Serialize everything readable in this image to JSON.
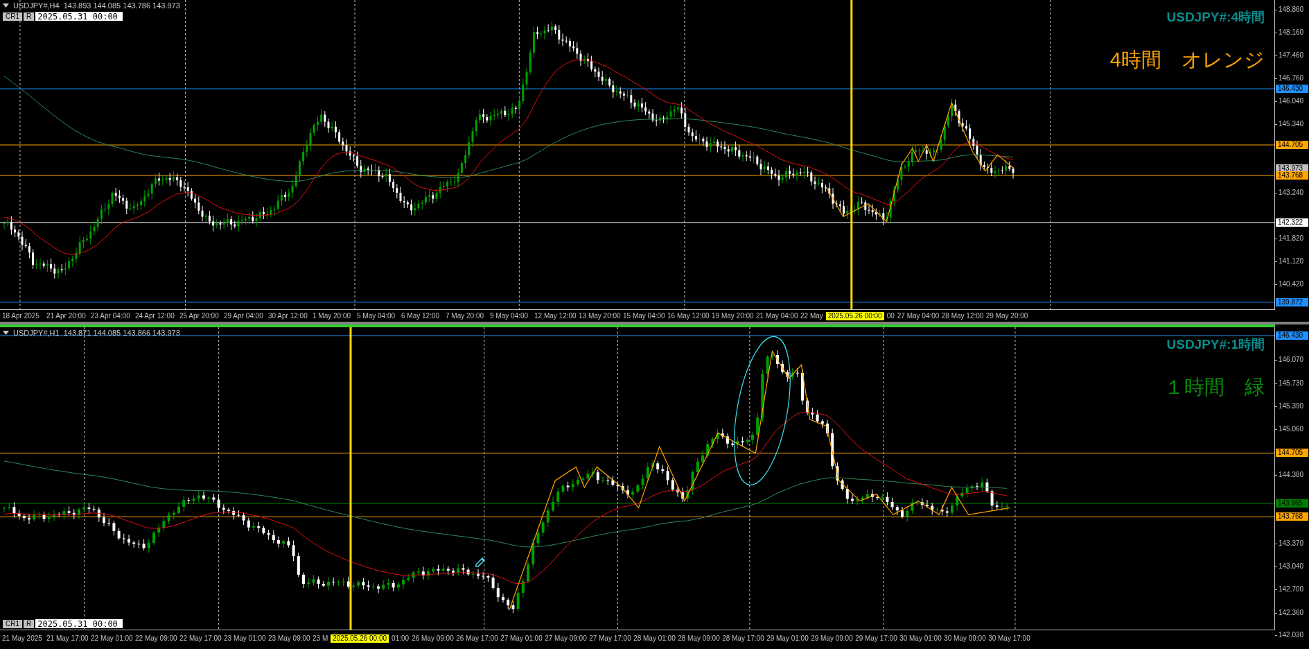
{
  "panels": [
    {
      "header": {
        "symbol": "USDJPY#,H4",
        "ohlc": "143.893 144.085 143.786 143.973"
      },
      "controls": {
        "buttons": [
          "CR1",
          "R"
        ],
        "date": "2025.05.31 00:00"
      },
      "title": "USDJPY#:4時間",
      "note": {
        "text": "4時間　オレンジ",
        "color": "#ffa500"
      },
      "price_ticks": [
        "148.860",
        "148.160",
        "147.460",
        "146.760",
        "146.040",
        "145.340",
        "143.240",
        "141.820",
        "141.120",
        "140.420"
      ],
      "price_labels": [
        {
          "text": "146.430",
          "color": "#1e90ff",
          "kind": "level"
        },
        {
          "text": "144.705",
          "color": "#ffa500",
          "kind": "level"
        },
        {
          "text": "143.973",
          "color": "#c0c0c0",
          "kind": "bid"
        },
        {
          "text": "143.768",
          "color": "#ffa500",
          "kind": "level"
        },
        {
          "text": "142.322",
          "color": "#ffffff",
          "kind": "level"
        },
        {
          "text": "139.872",
          "color": "#1e90ff",
          "kind": "level"
        }
      ],
      "time_labels": [
        {
          "text": "18 Apr 2025",
          "kind": "tick"
        },
        {
          "text": "21 Apr 20:00",
          "kind": "tick"
        },
        {
          "text": "23 Apr 04:00",
          "kind": "tick"
        },
        {
          "text": "24 Apr 12:00",
          "kind": "tick"
        },
        {
          "text": "25 Apr 20:00",
          "kind": "tick"
        },
        {
          "text": "29 Apr 04:00",
          "kind": "tick"
        },
        {
          "text": "30 Apr 12:00",
          "kind": "tick"
        },
        {
          "text": "1 May 20:00",
          "kind": "tick"
        },
        {
          "text": "5 May 04:00",
          "kind": "tick"
        },
        {
          "text": "6 May 12:00",
          "kind": "tick"
        },
        {
          "text": "7 May 20:00",
          "kind": "tick"
        },
        {
          "text": "9 May 04:00",
          "kind": "tick"
        },
        {
          "text": "12 May 12:00",
          "kind": "tick"
        },
        {
          "text": "13 May 20:00",
          "kind": "tick"
        },
        {
          "text": "15 May 04:00",
          "kind": "tick"
        },
        {
          "text": "16 May 12:00",
          "kind": "tick"
        },
        {
          "text": "19 May 20:00",
          "kind": "tick"
        },
        {
          "text": "21 May 04:00",
          "kind": "tick"
        },
        {
          "text": "22 May",
          "kind": "partial"
        },
        {
          "text": "2025.05.26 00:00",
          "kind": "highlight"
        },
        {
          "text": "00",
          "kind": "partial"
        },
        {
          "text": "27 May 04:00",
          "kind": "tick"
        },
        {
          "text": "28 May 12:00",
          "kind": "tick"
        },
        {
          "text": "29 May 20:00",
          "kind": "tick"
        }
      ]
    },
    {
      "header": {
        "symbol": "USDJPY#,H1",
        "ohlc": "143.871 144.085 143.866 143.973"
      },
      "controls": {
        "buttons": [
          "CR1",
          "R"
        ],
        "date": "2025.05.31 00:00"
      },
      "title": "USDJPY#:1時間",
      "note": {
        "text": "１時間　緑",
        "color": "#0a8a0a"
      },
      "price_ticks": [
        "146.070",
        "145.730",
        "145.390",
        "145.060",
        "144.380",
        "143.370",
        "143.040",
        "142.700",
        "142.360",
        "142.030"
      ],
      "price_labels": [
        {
          "text": "146.430",
          "color": "#1e90ff",
          "kind": "level"
        },
        {
          "text": "144.705",
          "color": "#ffa500",
          "kind": "level"
        },
        {
          "text": "143.965",
          "color": "#008000",
          "kind": "level"
        },
        {
          "text": "143.768",
          "color": "#ffa500",
          "kind": "level"
        }
      ],
      "time_labels": [
        {
          "text": "21 May 2025",
          "kind": "tick"
        },
        {
          "text": "21 May 17:00",
          "kind": "tick"
        },
        {
          "text": "22 May 01:00",
          "kind": "tick"
        },
        {
          "text": "22 May 09:00",
          "kind": "tick"
        },
        {
          "text": "22 May 17:00",
          "kind": "tick"
        },
        {
          "text": "23 May 01:00",
          "kind": "tick"
        },
        {
          "text": "23 May 09:00",
          "kind": "tick"
        },
        {
          "text": "23 M",
          "kind": "partial"
        },
        {
          "text": "2025.05.26 00:00",
          "kind": "highlight"
        },
        {
          "text": "01:00",
          "kind": "partial"
        },
        {
          "text": "26 May 09:00",
          "kind": "tick"
        },
        {
          "text": "26 May 17:00",
          "kind": "tick"
        },
        {
          "text": "27 May 01:00",
          "kind": "tick"
        },
        {
          "text": "27 May 09:00",
          "kind": "tick"
        },
        {
          "text": "27 May 17:00",
          "kind": "tick"
        },
        {
          "text": "28 May 01:00",
          "kind": "tick"
        },
        {
          "text": "28 May 09:00",
          "kind": "tick"
        },
        {
          "text": "28 May 17:00",
          "kind": "tick"
        },
        {
          "text": "29 May 01:00",
          "kind": "tick"
        },
        {
          "text": "29 May 09:00",
          "kind": "tick"
        },
        {
          "text": "29 May 17:00",
          "kind": "tick"
        },
        {
          "text": "30 May 01:00",
          "kind": "tick"
        },
        {
          "text": "30 May 09:00",
          "kind": "tick"
        },
        {
          "text": "30 May 17:00",
          "kind": "tick"
        }
      ]
    }
  ]
}
